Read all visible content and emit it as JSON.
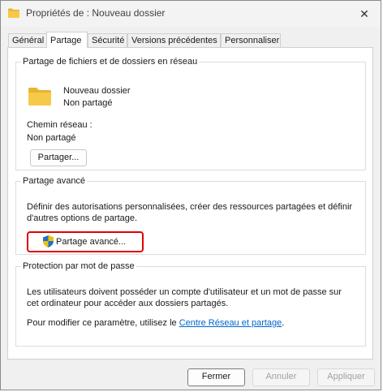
{
  "window": {
    "title": "Propriétés de : Nouveau dossier",
    "close_glyph": "✕"
  },
  "tabs": [
    {
      "label": "Général"
    },
    {
      "label": "Partage"
    },
    {
      "label": "Sécurité"
    },
    {
      "label": "Versions précédentes"
    },
    {
      "label": "Personnaliser"
    }
  ],
  "network_sharing": {
    "legend": "Partage de fichiers et de dossiers en réseau",
    "folder_name": "Nouveau dossier",
    "share_state": "Non partagé",
    "path_label": "Chemin réseau :",
    "path_value": "Non partagé",
    "share_button": "Partager..."
  },
  "advanced_sharing": {
    "legend": "Partage avancé",
    "description_line1": "Définir des autorisations personnalisées, créer des ressources partagées et définir",
    "description_line2": "d'autres options de partage.",
    "button": "Partage avancé..."
  },
  "password_protection": {
    "legend": "Protection par mot de passe",
    "description_line1": "Les utilisateurs doivent posséder un compte d'utilisateur et un mot de passe sur",
    "description_line2": "cet ordinateur pour accéder aux dossiers partagés.",
    "modify_prefix": "Pour modifier ce paramètre, utilisez le ",
    "link": "Centre Réseau et partage",
    "modify_suffix": "."
  },
  "footer": {
    "close_button": "Fermer",
    "cancel_button": "Annuler",
    "apply_button": "Appliquer"
  },
  "colors": {
    "folder": "#f5c244",
    "highlight": "#e00000",
    "link": "#0066cc",
    "shield_blue": "#1e6fd0",
    "shield_yellow": "#f2c200"
  },
  "icons": {
    "title": "folder-icon",
    "share_folder": "folder-icon",
    "advanced_button": "uac-shield-icon",
    "close": "close-icon"
  }
}
